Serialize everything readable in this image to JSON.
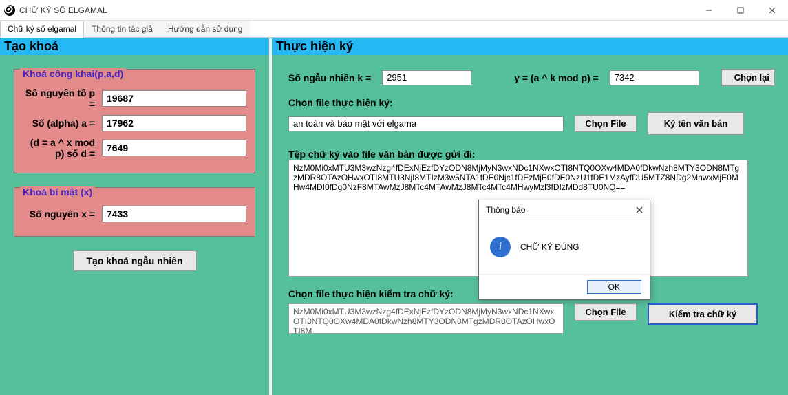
{
  "window": {
    "title": "CHỮ KÝ SỐ ELGAMAL"
  },
  "tabs": {
    "t0": "Chữ ký số elgamal",
    "t1": "Thông tin tác giả",
    "t2": "Hướng dẫn sử dụng"
  },
  "left": {
    "header": "Tạo khoá",
    "group_public_legend": "Khoá công khai(p,a,d)",
    "label_p": "Số nguyên tố p =",
    "value_p": "19687",
    "label_a": "Số (alpha) a =",
    "value_a": "17962",
    "label_d": "(d = a ^ x mod p) số d =",
    "value_d": "7649",
    "group_secret_legend": "Khoá bí mật (x)",
    "label_x": "Số nguyên x =",
    "value_x": "7433",
    "btn_gen": "Tạo khoá ngẫu nhiên"
  },
  "right": {
    "header": "Thực hiện ký",
    "label_k": "Số ngẫu nhiên k =",
    "value_k": "2951",
    "label_y": "y = (a ^ k mod p) =",
    "value_y": "7342",
    "btn_choose_again": "Chọn lại",
    "label_choose_file_sign": "Chọn file thực hiện ký:",
    "value_file_sign": "an toàn và bảo mật với elgama",
    "btn_choose_file": "Chọn File",
    "btn_sign": "Ký tên văn bản",
    "label_sig_sent": "Tệp chữ ký vào file văn bản được gửi đi:",
    "value_sig_sent": "NzM0Mi0xMTU3M3wzNzg4fDExNjEzfDYzODN8MjMyN3wxNDc1NXwxOTI8NTQ0OXw4MDA0fDkwNzh8MTY3ODN8MTgzMDR8OTAzOHwxOTI8MTU3NjI8MTIzM3w5NTA1fDE0Njc1fDEzMjE0fDE0NzU1fDE1MzAyfDU5MTZ8NDg2MnwxMjE0MHw4MDI0fDg0NzF8MTAwMzJ8MTc4MTAwMzJ8MTc4MTc4MHwyMzl3fDIzMDd8TU0NQ==",
    "label_choose_file_verify": "Chọn file thực hiện kiểm tra chữ ký:",
    "value_file_verify": "NzM0Mi0xMTU3M3wzNzg4fDExNjEzfDYzODN8MjMyN3wxNDc1NXwxOTI8NTQ0OXw4MDA0fDkwNzh8MTY3ODN8MTgzMDR8OTAzOHwxOTI8M",
    "btn_choose_file2": "Chọn File",
    "btn_verify": "Kiểm tra chữ ký"
  },
  "modal": {
    "title": "Thông báo",
    "message": "CHỮ KÝ ĐÚNG",
    "ok": "OK"
  }
}
